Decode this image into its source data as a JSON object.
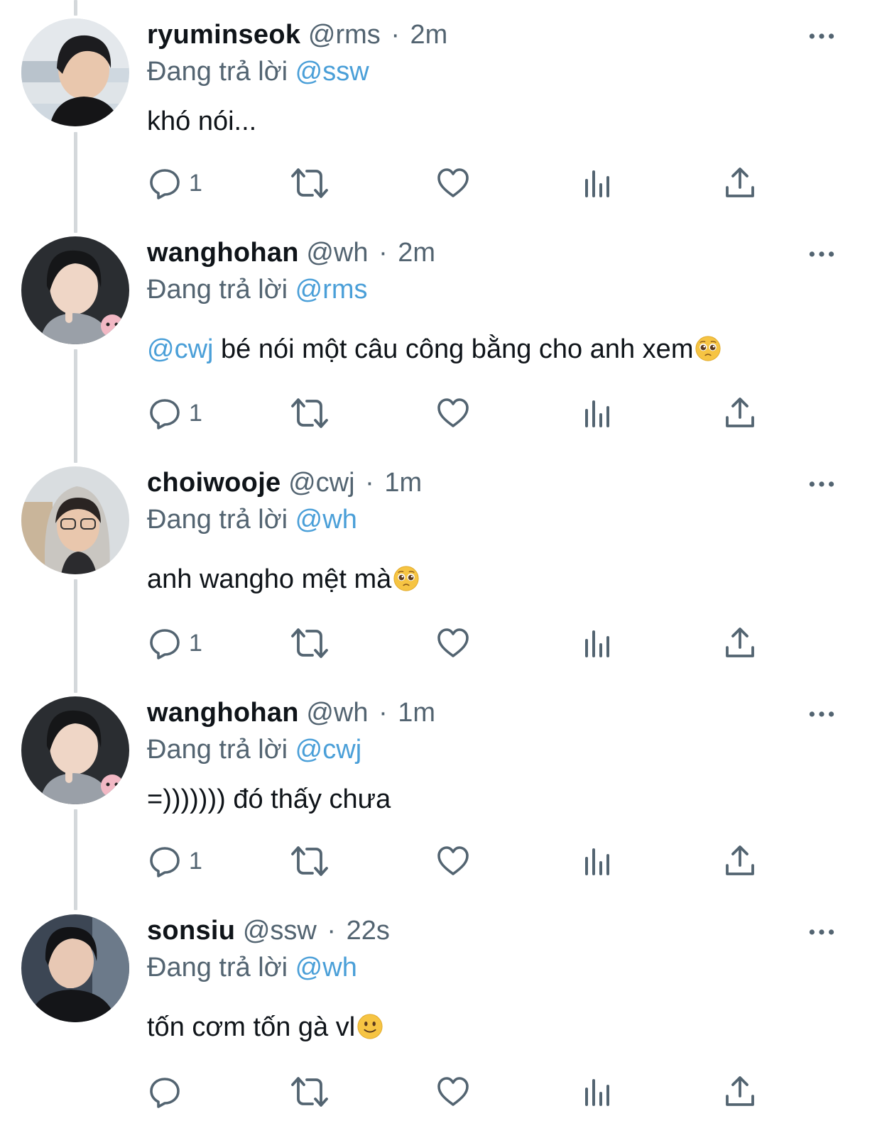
{
  "replying_prefix": "Đang trả lời",
  "colors": {
    "text": "#0f1419",
    "muted": "#536471",
    "accent": "#4a9fd8",
    "thread_line": "#d4d8db"
  },
  "icons": [
    "reply-icon",
    "retweet-icon",
    "like-icon",
    "views-icon",
    "share-icon",
    "more-icon"
  ],
  "tweets": [
    {
      "name": "ryuminseok",
      "handle": "@rms",
      "separator": "·",
      "time": "2m",
      "replying_to": "@ssw",
      "body_mention": "",
      "body_text": "khó nói...",
      "emoji": "",
      "reply_count": "1"
    },
    {
      "name": "wanghohan",
      "handle": "@wh",
      "separator": "·",
      "time": "2m",
      "replying_to": "@rms",
      "body_mention": "@cwj",
      "body_text": " bé nói một câu công bằng cho anh xem",
      "emoji": "pleading-face",
      "reply_count": "1"
    },
    {
      "name": "choiwooje",
      "handle": "@cwj",
      "separator": "·",
      "time": "1m",
      "replying_to": "@wh",
      "body_mention": "",
      "body_text": "anh wangho mệt mà",
      "emoji": "pleading-face",
      "reply_count": "1"
    },
    {
      "name": "wanghohan",
      "handle": "@wh",
      "separator": "·",
      "time": "1m",
      "replying_to": "@cwj",
      "body_mention": "",
      "body_text": "=))))))) đó thấy chưa",
      "emoji": "",
      "reply_count": "1"
    },
    {
      "name": "sonsiu",
      "handle": "@ssw",
      "separator": "·",
      "time": "22s",
      "replying_to": "@wh",
      "body_mention": "",
      "body_text": "tốn cơm tốn gà vl",
      "emoji": "slightly-smiling-face",
      "reply_count": ""
    }
  ]
}
